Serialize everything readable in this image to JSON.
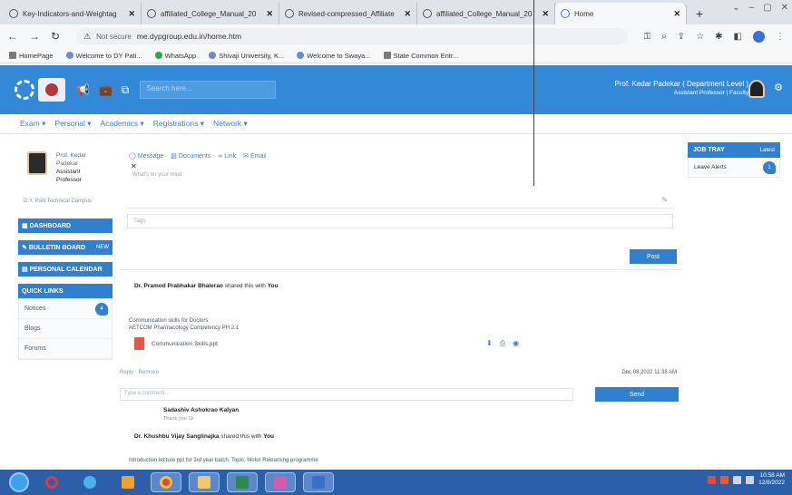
{
  "browser": {
    "tabs": [
      {
        "title": "Key-Indicators-and-Weightag",
        "active": false
      },
      {
        "title": "affiliated_College_Manual_20",
        "active": false
      },
      {
        "title": "Revised-compressed_Affiliate",
        "active": false
      },
      {
        "title": "affiliated_College_Manual_20",
        "active": false
      },
      {
        "title": "Home",
        "active": true
      }
    ],
    "new_tab": "+",
    "url": "me.dypgroup.edu.in/home.htm",
    "security_label": "Not secure",
    "bookmarks": [
      "HomePage",
      "Welcome to DY Pati...",
      "WhatsApp",
      "Shivaji University, K...",
      "Welcome to Swaya...",
      "State Common Entr..."
    ]
  },
  "header": {
    "search_placeholder": "Search here...",
    "user_name": "Prof. Kedar Padekar ( Department Level )",
    "user_role": "Assistant Professor | Faculty"
  },
  "menu": [
    "Exam ▾",
    "Personal ▾",
    "Academics ▾",
    "Registrations ▾",
    "Network ▾"
  ],
  "profile": {
    "lines": [
      "Prof. Kedar",
      "Padekar",
      "Assistant",
      "Professor"
    ],
    "department": "D.Y. Patil Technical Campus"
  },
  "sidebar": {
    "dashboard": "DASHBOARD",
    "bulletin": "BULLETIN BOARD",
    "bulletin_badge": "NEW",
    "calendar": "PERSONAL CALENDAR",
    "quick_links": "QUICK LINKS",
    "items": [
      {
        "label": "Notices",
        "count": "4"
      },
      {
        "label": "Blogs",
        "count": ""
      },
      {
        "label": "Forums",
        "count": ""
      }
    ]
  },
  "composer": {
    "tabs": [
      "Message",
      "Documents",
      "Link",
      "Email"
    ],
    "hint": "What's on your mind",
    "tags_placeholder": "Tags",
    "post_label": "Post"
  },
  "feed": {
    "post1": {
      "author": "Dr. Pramod Prabhakar Bhalerao",
      "shared": "shared this with",
      "target": "You",
      "body": [
        "Communication skills for Doctors",
        "AETCOM Pharmacology Competency PH 2.1"
      ],
      "file": "Communication Skills.ppt",
      "reply": "Reply · Remove",
      "date": "Dec 08,2022 11:38 AM"
    },
    "comment_placeholder": "Type a comment...",
    "send_label": "Send",
    "comment": {
      "name": "Sadashiv Ashokrao Kalyan",
      "time": "Thank you Sir"
    },
    "post2": {
      "author": "Dr. Khushbu Vijay Sanglinajka",
      "shared": "shared this with",
      "target": "You",
      "body": "Introduction lecture ppt for 3rd year batch. Topic: Motor Relearning programme"
    }
  },
  "jobtray": {
    "title": "JOB TRAY",
    "latest": "Latest",
    "items": [
      {
        "label": "Leave Alerts",
        "count": "1"
      }
    ]
  },
  "taskbar": {
    "clock_time": "10:58 AM",
    "clock_date": "12/8/2022"
  }
}
